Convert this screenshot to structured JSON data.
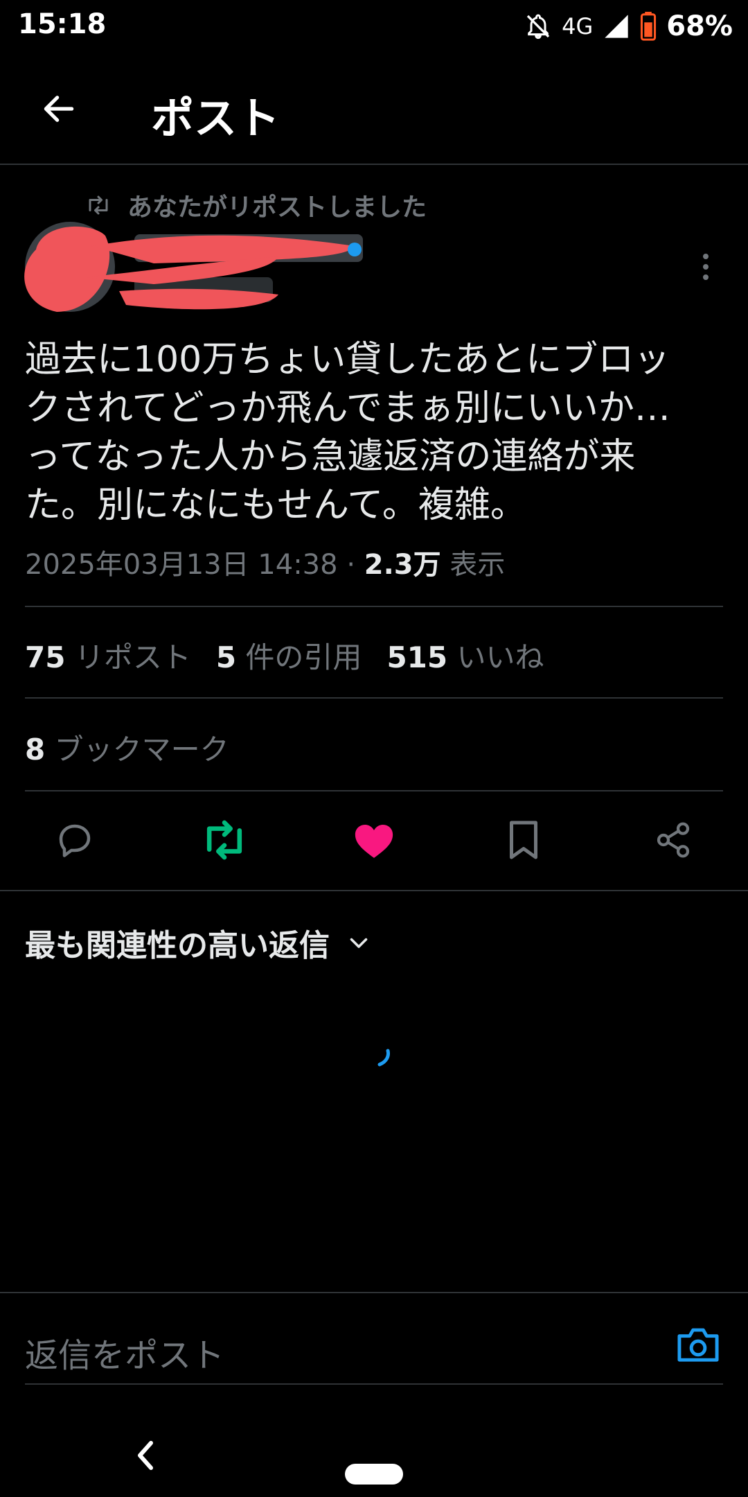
{
  "status_bar": {
    "time": "15:18",
    "network": "4G",
    "battery": "68%"
  },
  "header": {
    "title": "ポスト"
  },
  "repost_context": {
    "text": "あなたがリポストしました"
  },
  "post": {
    "text": "過去に100万ちょい貸したあとにブロッ\nクされてどっか飛んでまぁ別にいいか…\nってなった人から急遽返済の連絡が来\nた。別になにもせんて。複雑。",
    "timestamp": "2025年03月13日 14:38",
    "views_count": "2.3万",
    "views_label": "表示"
  },
  "stats": {
    "reposts_count": "75",
    "reposts_label": "リポスト",
    "quotes_count": "5",
    "quotes_label": "件の引用",
    "likes_count": "515",
    "likes_label": "いいね",
    "bookmarks_count": "8",
    "bookmarks_label": "ブックマーク"
  },
  "actions": {
    "reply_icon": "reply-icon",
    "repost_icon": "repost-icon",
    "like_icon": "heart-icon",
    "bookmark_icon": "bookmark-icon",
    "share_icon": "share-icon",
    "repost_color": "#00ba7c",
    "like_color": "#f91880"
  },
  "replies": {
    "sort_label": "最も関連性の高い返信"
  },
  "reply_bar": {
    "placeholder": "返信をポスト",
    "accent_color": "#1d9bf0"
  }
}
